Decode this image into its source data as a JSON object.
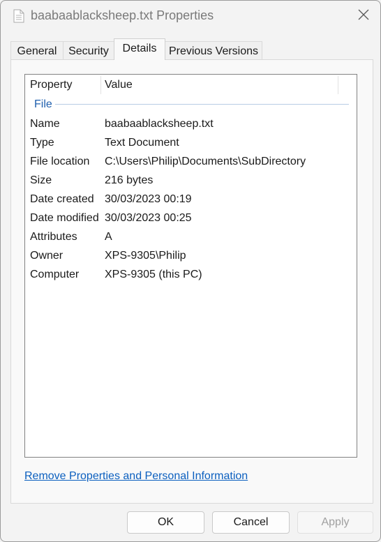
{
  "window": {
    "title": "baabaablacksheep.txt Properties"
  },
  "tabs": [
    {
      "label": "General"
    },
    {
      "label": "Security"
    },
    {
      "label": "Details"
    },
    {
      "label": "Previous Versions"
    }
  ],
  "active_tab": "Details",
  "details": {
    "columns": {
      "property": "Property",
      "value": "Value"
    },
    "group_label": "File",
    "rows": [
      {
        "property": "Name",
        "value": "baabaablacksheep.txt"
      },
      {
        "property": "Type",
        "value": "Text Document"
      },
      {
        "property": "File location",
        "value": "C:\\Users\\Philip\\Documents\\SubDirectory"
      },
      {
        "property": "Size",
        "value": "216 bytes"
      },
      {
        "property": "Date created",
        "value": "30/03/2023 00:19"
      },
      {
        "property": "Date modified",
        "value": "30/03/2023 00:25"
      },
      {
        "property": "Attributes",
        "value": "A"
      },
      {
        "property": "Owner",
        "value": "XPS-9305\\Philip"
      },
      {
        "property": "Computer",
        "value": "XPS-9305 (this PC)"
      }
    ],
    "remove_link": "Remove Properties and Personal Information"
  },
  "buttons": {
    "ok": "OK",
    "cancel": "Cancel",
    "apply": "Apply"
  },
  "icons": {
    "file": "text-file-icon",
    "close": "close-icon"
  }
}
